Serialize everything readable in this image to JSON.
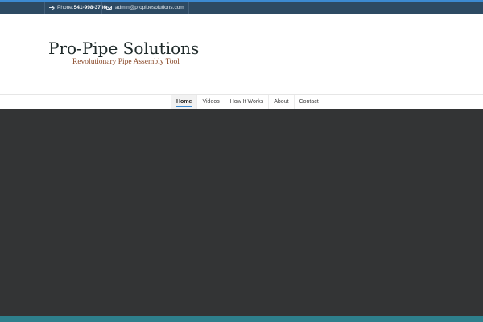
{
  "topbar": {
    "phone_label": "Phone:",
    "phone_number": "541-998-3736",
    "email": "admin@propipesolutions.com",
    "icons": {
      "phone": "arrow-right-icon",
      "email": "envelope-icon"
    }
  },
  "header": {
    "title": "Pro-Pipe Solutions",
    "tagline": "Revolutionary Pipe Assembly Tool"
  },
  "nav": {
    "items": [
      {
        "label": "Home",
        "active": true
      },
      {
        "label": "Videos"
      },
      {
        "label": "How It Works"
      },
      {
        "label": "About"
      },
      {
        "label": "Contact"
      }
    ]
  },
  "colors": {
    "topbar": "#2d4a63",
    "accent": "#3c8ad2",
    "hero": "#333435",
    "footer": "#2e7f8c",
    "tagline": "#8a4a2a"
  }
}
